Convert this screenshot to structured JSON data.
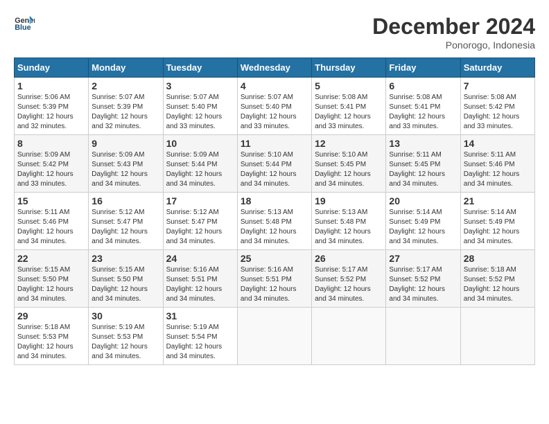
{
  "header": {
    "logo_line1": "General",
    "logo_line2": "Blue",
    "title": "December 2024",
    "subtitle": "Ponorogo, Indonesia"
  },
  "calendar": {
    "days_of_week": [
      "Sunday",
      "Monday",
      "Tuesday",
      "Wednesday",
      "Thursday",
      "Friday",
      "Saturday"
    ],
    "weeks": [
      [
        {
          "day": "1",
          "info": "Sunrise: 5:06 AM\nSunset: 5:39 PM\nDaylight: 12 hours\nand 32 minutes."
        },
        {
          "day": "2",
          "info": "Sunrise: 5:07 AM\nSunset: 5:39 PM\nDaylight: 12 hours\nand 32 minutes."
        },
        {
          "day": "3",
          "info": "Sunrise: 5:07 AM\nSunset: 5:40 PM\nDaylight: 12 hours\nand 33 minutes."
        },
        {
          "day": "4",
          "info": "Sunrise: 5:07 AM\nSunset: 5:40 PM\nDaylight: 12 hours\nand 33 minutes."
        },
        {
          "day": "5",
          "info": "Sunrise: 5:08 AM\nSunset: 5:41 PM\nDaylight: 12 hours\nand 33 minutes."
        },
        {
          "day": "6",
          "info": "Sunrise: 5:08 AM\nSunset: 5:41 PM\nDaylight: 12 hours\nand 33 minutes."
        },
        {
          "day": "7",
          "info": "Sunrise: 5:08 AM\nSunset: 5:42 PM\nDaylight: 12 hours\nand 33 minutes."
        }
      ],
      [
        {
          "day": "8",
          "info": "Sunrise: 5:09 AM\nSunset: 5:42 PM\nDaylight: 12 hours\nand 33 minutes."
        },
        {
          "day": "9",
          "info": "Sunrise: 5:09 AM\nSunset: 5:43 PM\nDaylight: 12 hours\nand 34 minutes."
        },
        {
          "day": "10",
          "info": "Sunrise: 5:09 AM\nSunset: 5:44 PM\nDaylight: 12 hours\nand 34 minutes."
        },
        {
          "day": "11",
          "info": "Sunrise: 5:10 AM\nSunset: 5:44 PM\nDaylight: 12 hours\nand 34 minutes."
        },
        {
          "day": "12",
          "info": "Sunrise: 5:10 AM\nSunset: 5:45 PM\nDaylight: 12 hours\nand 34 minutes."
        },
        {
          "day": "13",
          "info": "Sunrise: 5:11 AM\nSunset: 5:45 PM\nDaylight: 12 hours\nand 34 minutes."
        },
        {
          "day": "14",
          "info": "Sunrise: 5:11 AM\nSunset: 5:46 PM\nDaylight: 12 hours\nand 34 minutes."
        }
      ],
      [
        {
          "day": "15",
          "info": "Sunrise: 5:11 AM\nSunset: 5:46 PM\nDaylight: 12 hours\nand 34 minutes."
        },
        {
          "day": "16",
          "info": "Sunrise: 5:12 AM\nSunset: 5:47 PM\nDaylight: 12 hours\nand 34 minutes."
        },
        {
          "day": "17",
          "info": "Sunrise: 5:12 AM\nSunset: 5:47 PM\nDaylight: 12 hours\nand 34 minutes."
        },
        {
          "day": "18",
          "info": "Sunrise: 5:13 AM\nSunset: 5:48 PM\nDaylight: 12 hours\nand 34 minutes."
        },
        {
          "day": "19",
          "info": "Sunrise: 5:13 AM\nSunset: 5:48 PM\nDaylight: 12 hours\nand 34 minutes."
        },
        {
          "day": "20",
          "info": "Sunrise: 5:14 AM\nSunset: 5:49 PM\nDaylight: 12 hours\nand 34 minutes."
        },
        {
          "day": "21",
          "info": "Sunrise: 5:14 AM\nSunset: 5:49 PM\nDaylight: 12 hours\nand 34 minutes."
        }
      ],
      [
        {
          "day": "22",
          "info": "Sunrise: 5:15 AM\nSunset: 5:50 PM\nDaylight: 12 hours\nand 34 minutes."
        },
        {
          "day": "23",
          "info": "Sunrise: 5:15 AM\nSunset: 5:50 PM\nDaylight: 12 hours\nand 34 minutes."
        },
        {
          "day": "24",
          "info": "Sunrise: 5:16 AM\nSunset: 5:51 PM\nDaylight: 12 hours\nand 34 minutes."
        },
        {
          "day": "25",
          "info": "Sunrise: 5:16 AM\nSunset: 5:51 PM\nDaylight: 12 hours\nand 34 minutes."
        },
        {
          "day": "26",
          "info": "Sunrise: 5:17 AM\nSunset: 5:52 PM\nDaylight: 12 hours\nand 34 minutes."
        },
        {
          "day": "27",
          "info": "Sunrise: 5:17 AM\nSunset: 5:52 PM\nDaylight: 12 hours\nand 34 minutes."
        },
        {
          "day": "28",
          "info": "Sunrise: 5:18 AM\nSunset: 5:52 PM\nDaylight: 12 hours\nand 34 minutes."
        }
      ],
      [
        {
          "day": "29",
          "info": "Sunrise: 5:18 AM\nSunset: 5:53 PM\nDaylight: 12 hours\nand 34 minutes."
        },
        {
          "day": "30",
          "info": "Sunrise: 5:19 AM\nSunset: 5:53 PM\nDaylight: 12 hours\nand 34 minutes."
        },
        {
          "day": "31",
          "info": "Sunrise: 5:19 AM\nSunset: 5:54 PM\nDaylight: 12 hours\nand 34 minutes."
        },
        {
          "day": "",
          "info": ""
        },
        {
          "day": "",
          "info": ""
        },
        {
          "day": "",
          "info": ""
        },
        {
          "day": "",
          "info": ""
        }
      ]
    ]
  }
}
